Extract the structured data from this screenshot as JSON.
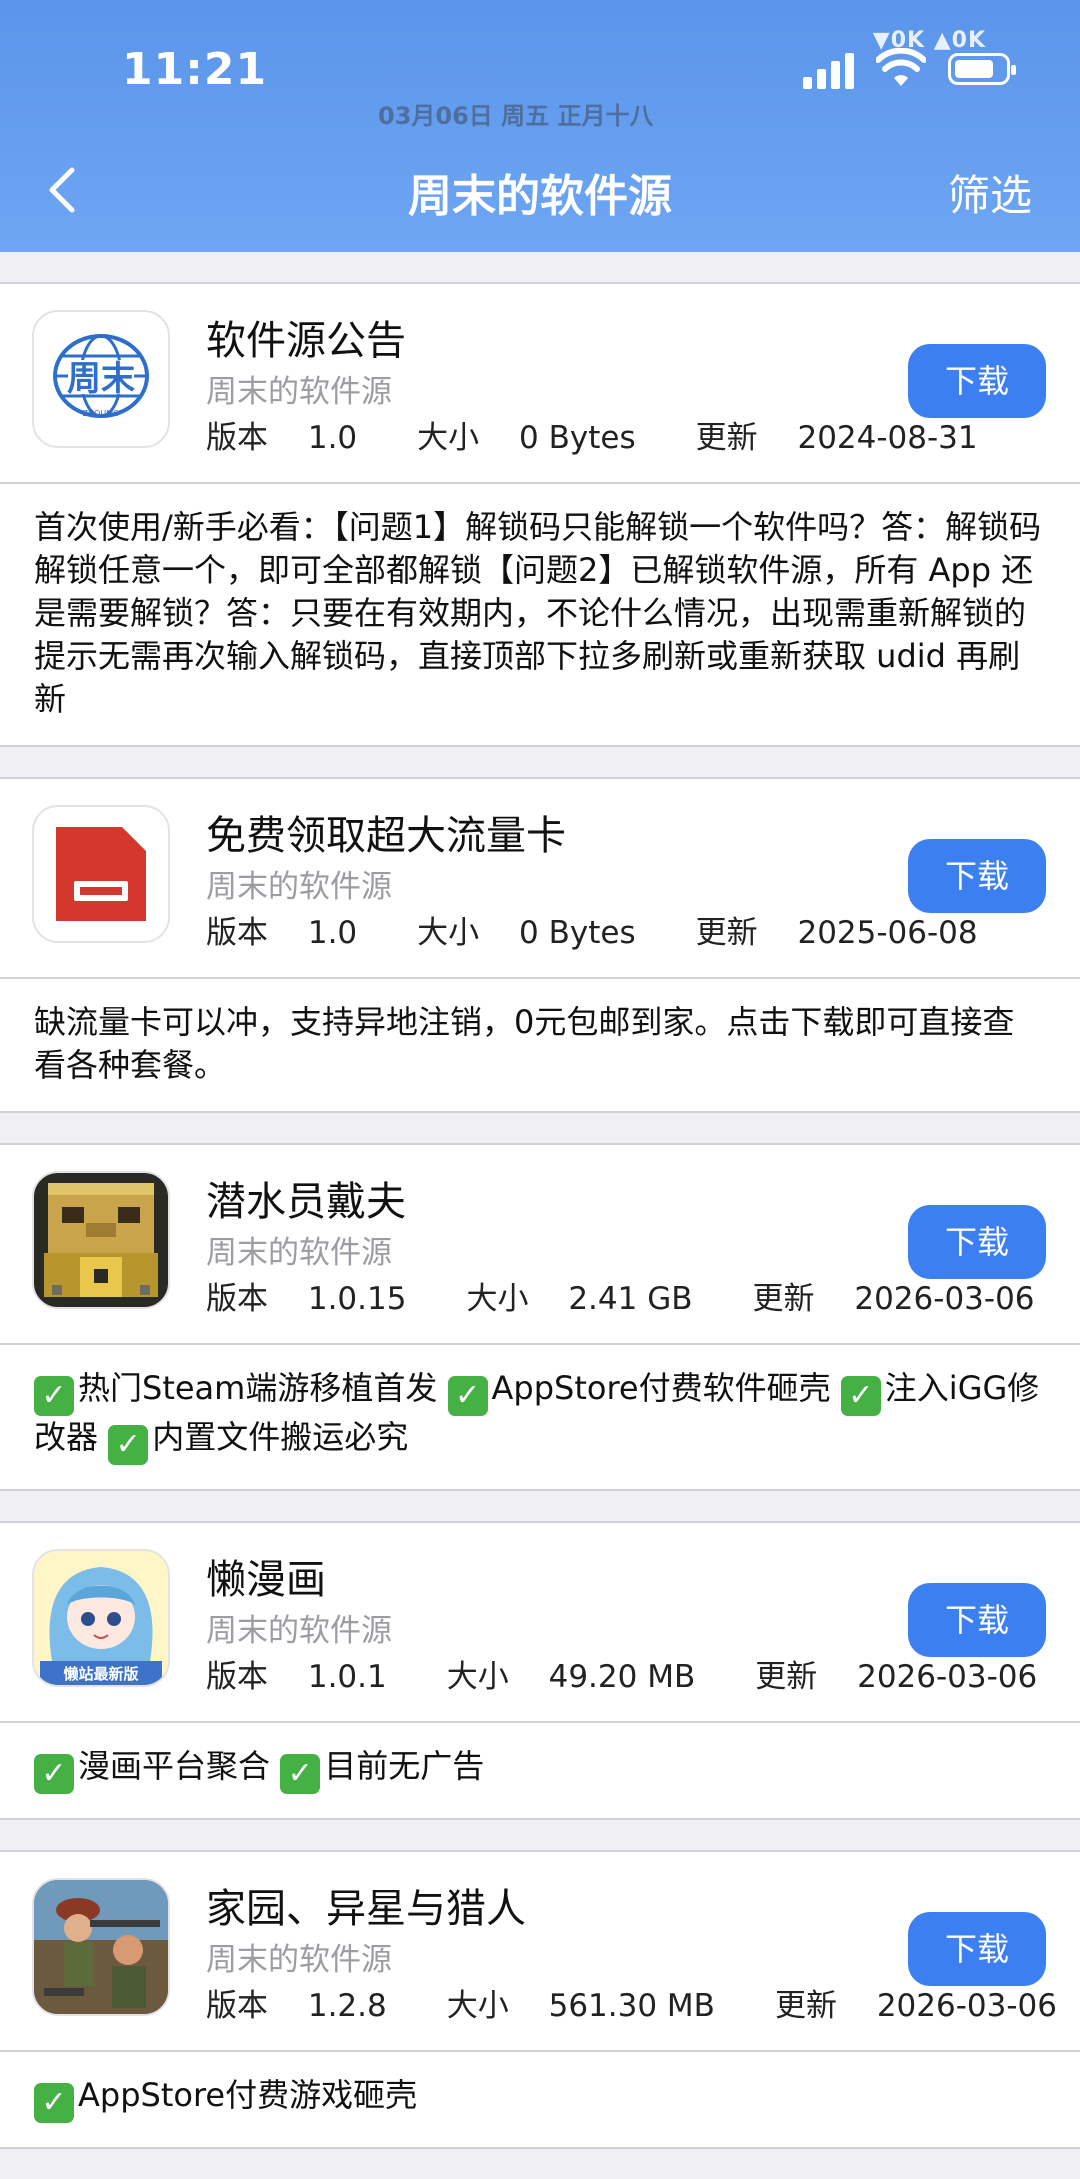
{
  "status_bar": {
    "time": "11:21",
    "date": "03月06日  周五 正月十八",
    "speed": "▼0K ▲0K"
  },
  "nav": {
    "title": "周末的软件源",
    "filter": "筛选"
  },
  "labels": {
    "version": "版本",
    "size": "大小",
    "updated": "更新",
    "download": "下载"
  },
  "apps": [
    {
      "name": "软件源公告",
      "source": "周末的软件源",
      "version": "1.0",
      "size": "0 Bytes",
      "updated": "2024-08-31",
      "description": "首次使用/新手必看：【问题1】解锁码只能解锁一个软件吗？答：解锁码解锁任意一个，即可全部都解锁【问题2】已解锁软件源，所有 App 还是需要解锁？答：只要在有效期内，不论什么情况，出现需重新解锁的提示无需再次输入解锁码，直接顶部下拉多刷新或重新获取 udid 再刷新",
      "icon": "globe-zhoumo-icon",
      "icon_text": "周末",
      "icon_subtext": "ZHOUMO"
    },
    {
      "name": "免费领取超大流量卡",
      "source": "周末的软件源",
      "version": "1.0",
      "size": "0 Bytes",
      "updated": "2025-06-08",
      "description": "缺流量卡可以冲，支持异地注销，0元包邮到家。点击下载即可直接查看各种套餐。",
      "icon": "sim-card-icon"
    },
    {
      "name": "潜水员戴夫",
      "source": "周末的软件源",
      "version": "1.0.15",
      "size": "2.41 GB",
      "updated": "2026-03-06",
      "features": [
        "热门Steam端游移植首发",
        "AppStore付费软件砸壳",
        "注入iGG修改器",
        "内置文件搬运必究"
      ],
      "icon": "diver-dave-icon"
    },
    {
      "name": "懒漫画",
      "source": "周末的软件源",
      "version": "1.0.1",
      "size": "49.20 MB",
      "updated": "2026-03-06",
      "features": [
        "漫画平台聚合",
        "目前无广告"
      ],
      "icon": "anime-girl-icon",
      "icon_text": "懒站最新版"
    },
    {
      "name": "家园、异星与猎人",
      "source": "周末的软件源",
      "version": "1.2.8",
      "size": "561.30 MB",
      "updated": "2026-03-06",
      "features": [
        "AppStore付费游戏砸壳"
      ],
      "icon": "soldiers-game-icon"
    }
  ]
}
